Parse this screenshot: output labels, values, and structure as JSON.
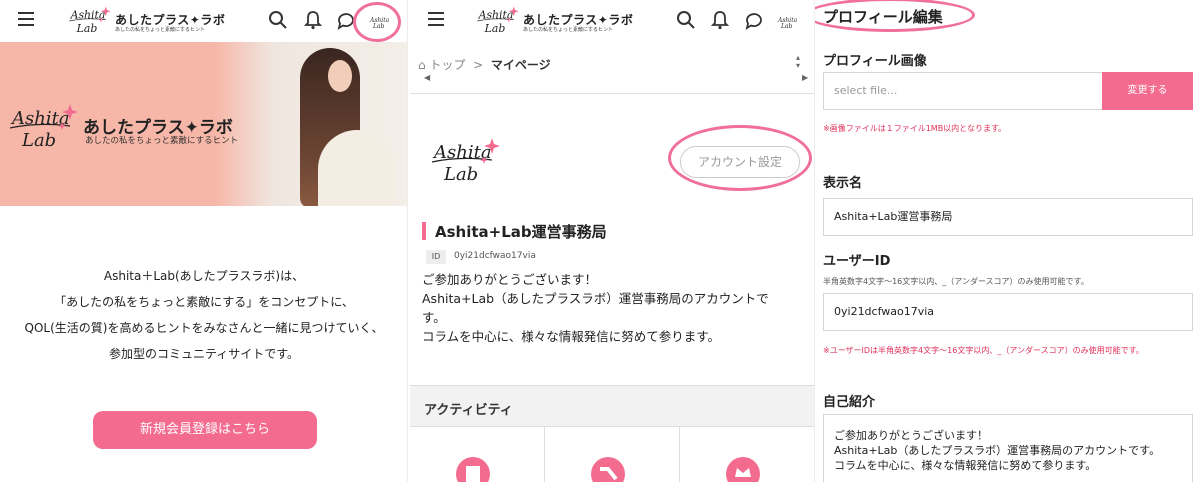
{
  "header": {
    "brand_name": "あしたプラス✦ラボ",
    "brand_tagline": "あしたの私をちょっと素敵にするヒント",
    "logo_text": "Ashita Lab"
  },
  "panel1": {
    "hero": {
      "brand_name": "あしたプラス✦ラボ",
      "tagline": "あしたの私をちょっと素敵にするヒント"
    },
    "intro_lines": [
      "Ashita＋Lab(あしたプラスラボ)は、",
      "「あしたの私をちょっと素敵にする」をコンセプトに、",
      "QOL(生活の質)を高めるヒントをみなさんと一緒に見つけていく、",
      "参加型のコミュニティサイトです。"
    ],
    "register_button": "新規会員登録はこちら"
  },
  "panel2": {
    "breadcrumb": {
      "home": "トップ",
      "separator": ">",
      "current": "マイページ"
    },
    "account_settings_button": "アカウント設定",
    "profile_name": "Ashita+Lab運営事務局",
    "id_label": "ID",
    "id_value": "0yi21dcfwao17via",
    "bio_lines": [
      "ご参加ありがとうございます！",
      "Ashita+Lab（あしたプラスラボ）運営事務局のアカウントで",
      "す。",
      "コラムを中心に、様々な情報発信に努めて参ります。"
    ],
    "activity_title": "アクティビティ"
  },
  "panel3": {
    "title": "プロフィール編集",
    "profile_image_label": "プロフィール画像",
    "file_placeholder": "select file...",
    "change_button": "変更する",
    "image_note": "※画像ファイルは１ファイル1MB以内となります。",
    "display_name_label": "表示名",
    "display_name_value": "Ashita+Lab運営事務局",
    "user_id_label": "ユーザーID",
    "user_id_hint": "半角英数字4文字〜16文字以内、_（アンダースコア）のみ使用可能です。",
    "user_id_value": "0yi21dcfwao17via",
    "user_id_error": "※ユーザーIDは半角英数字4文字〜16文字以内、_（アンダースコア）のみ使用可能です。",
    "bio_label": "自己紹介",
    "bio_lines": [
      "ご参加ありがとうございます！",
      "Ashita+Lab（あしたプラスラボ）運営事務局のアカウントです。",
      "コラムを中心に、様々な情報発信に努めて参ります。"
    ]
  },
  "colors": {
    "accent": "#f36b8f",
    "highlight_ring": "#f06f9b",
    "hero_bg": "#f7b7a8"
  }
}
